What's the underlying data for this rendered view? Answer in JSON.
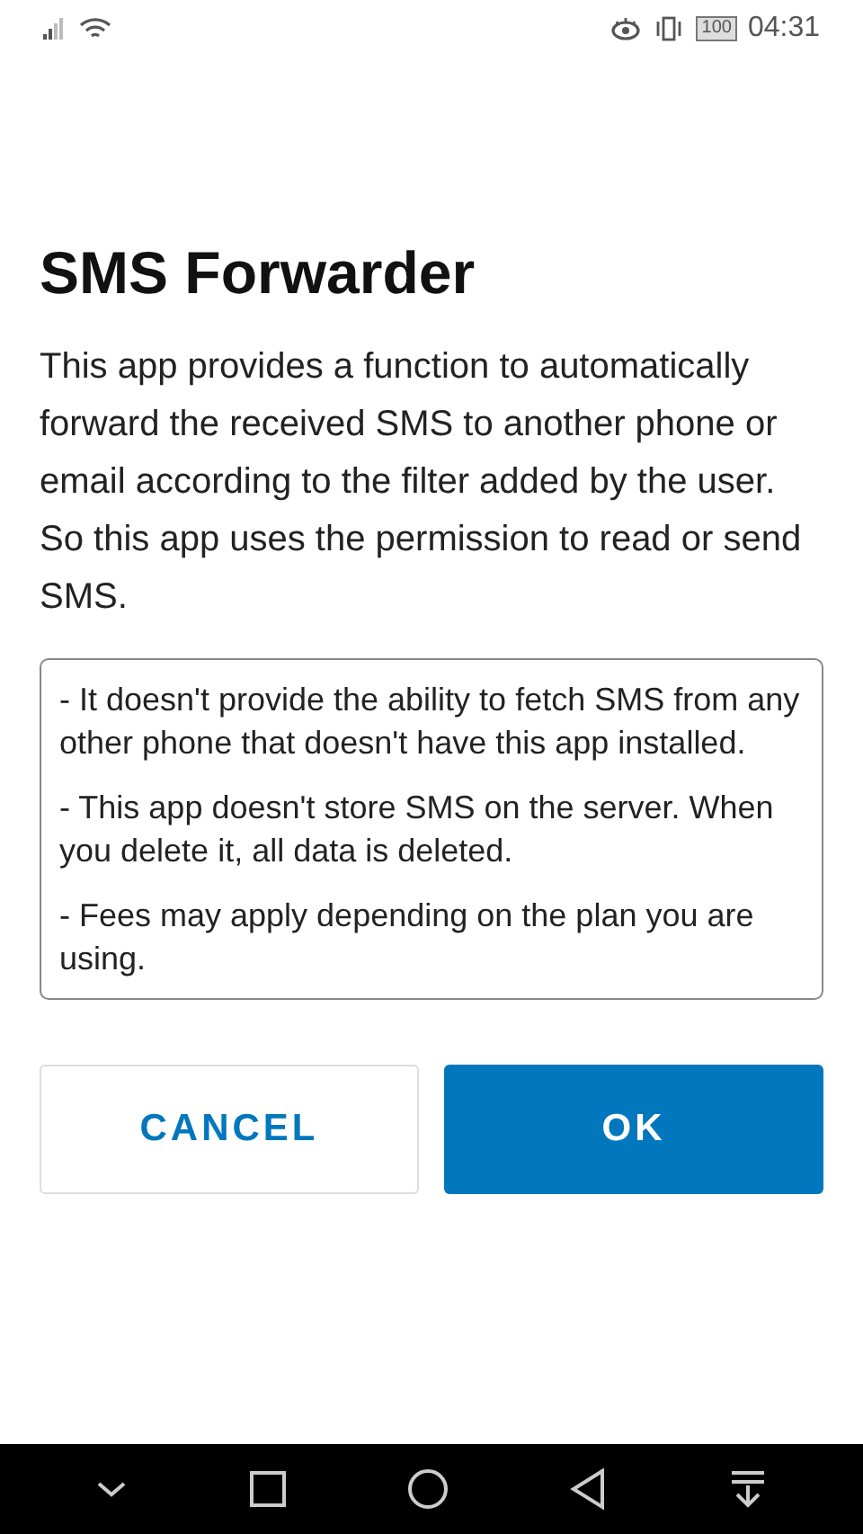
{
  "status_bar": {
    "battery": "100",
    "time": "04:31"
  },
  "dialog": {
    "title": "SMS Forwarder",
    "description": "This app provides a function to automatically forward the received SMS to another phone or email according to the filter added by the user. So this app uses the permission to read or send SMS.",
    "notes": [
      "- It doesn't provide the ability to fetch SMS from any other phone that doesn't have this app installed.",
      "- This app doesn't store SMS on the server. When you delete it, all data is deleted.",
      "- Fees may apply depending on the plan you are using."
    ],
    "buttons": [
      {
        "label": "CANCEL",
        "kind": "secondary"
      },
      {
        "label": "OK",
        "kind": "primary"
      }
    ]
  }
}
